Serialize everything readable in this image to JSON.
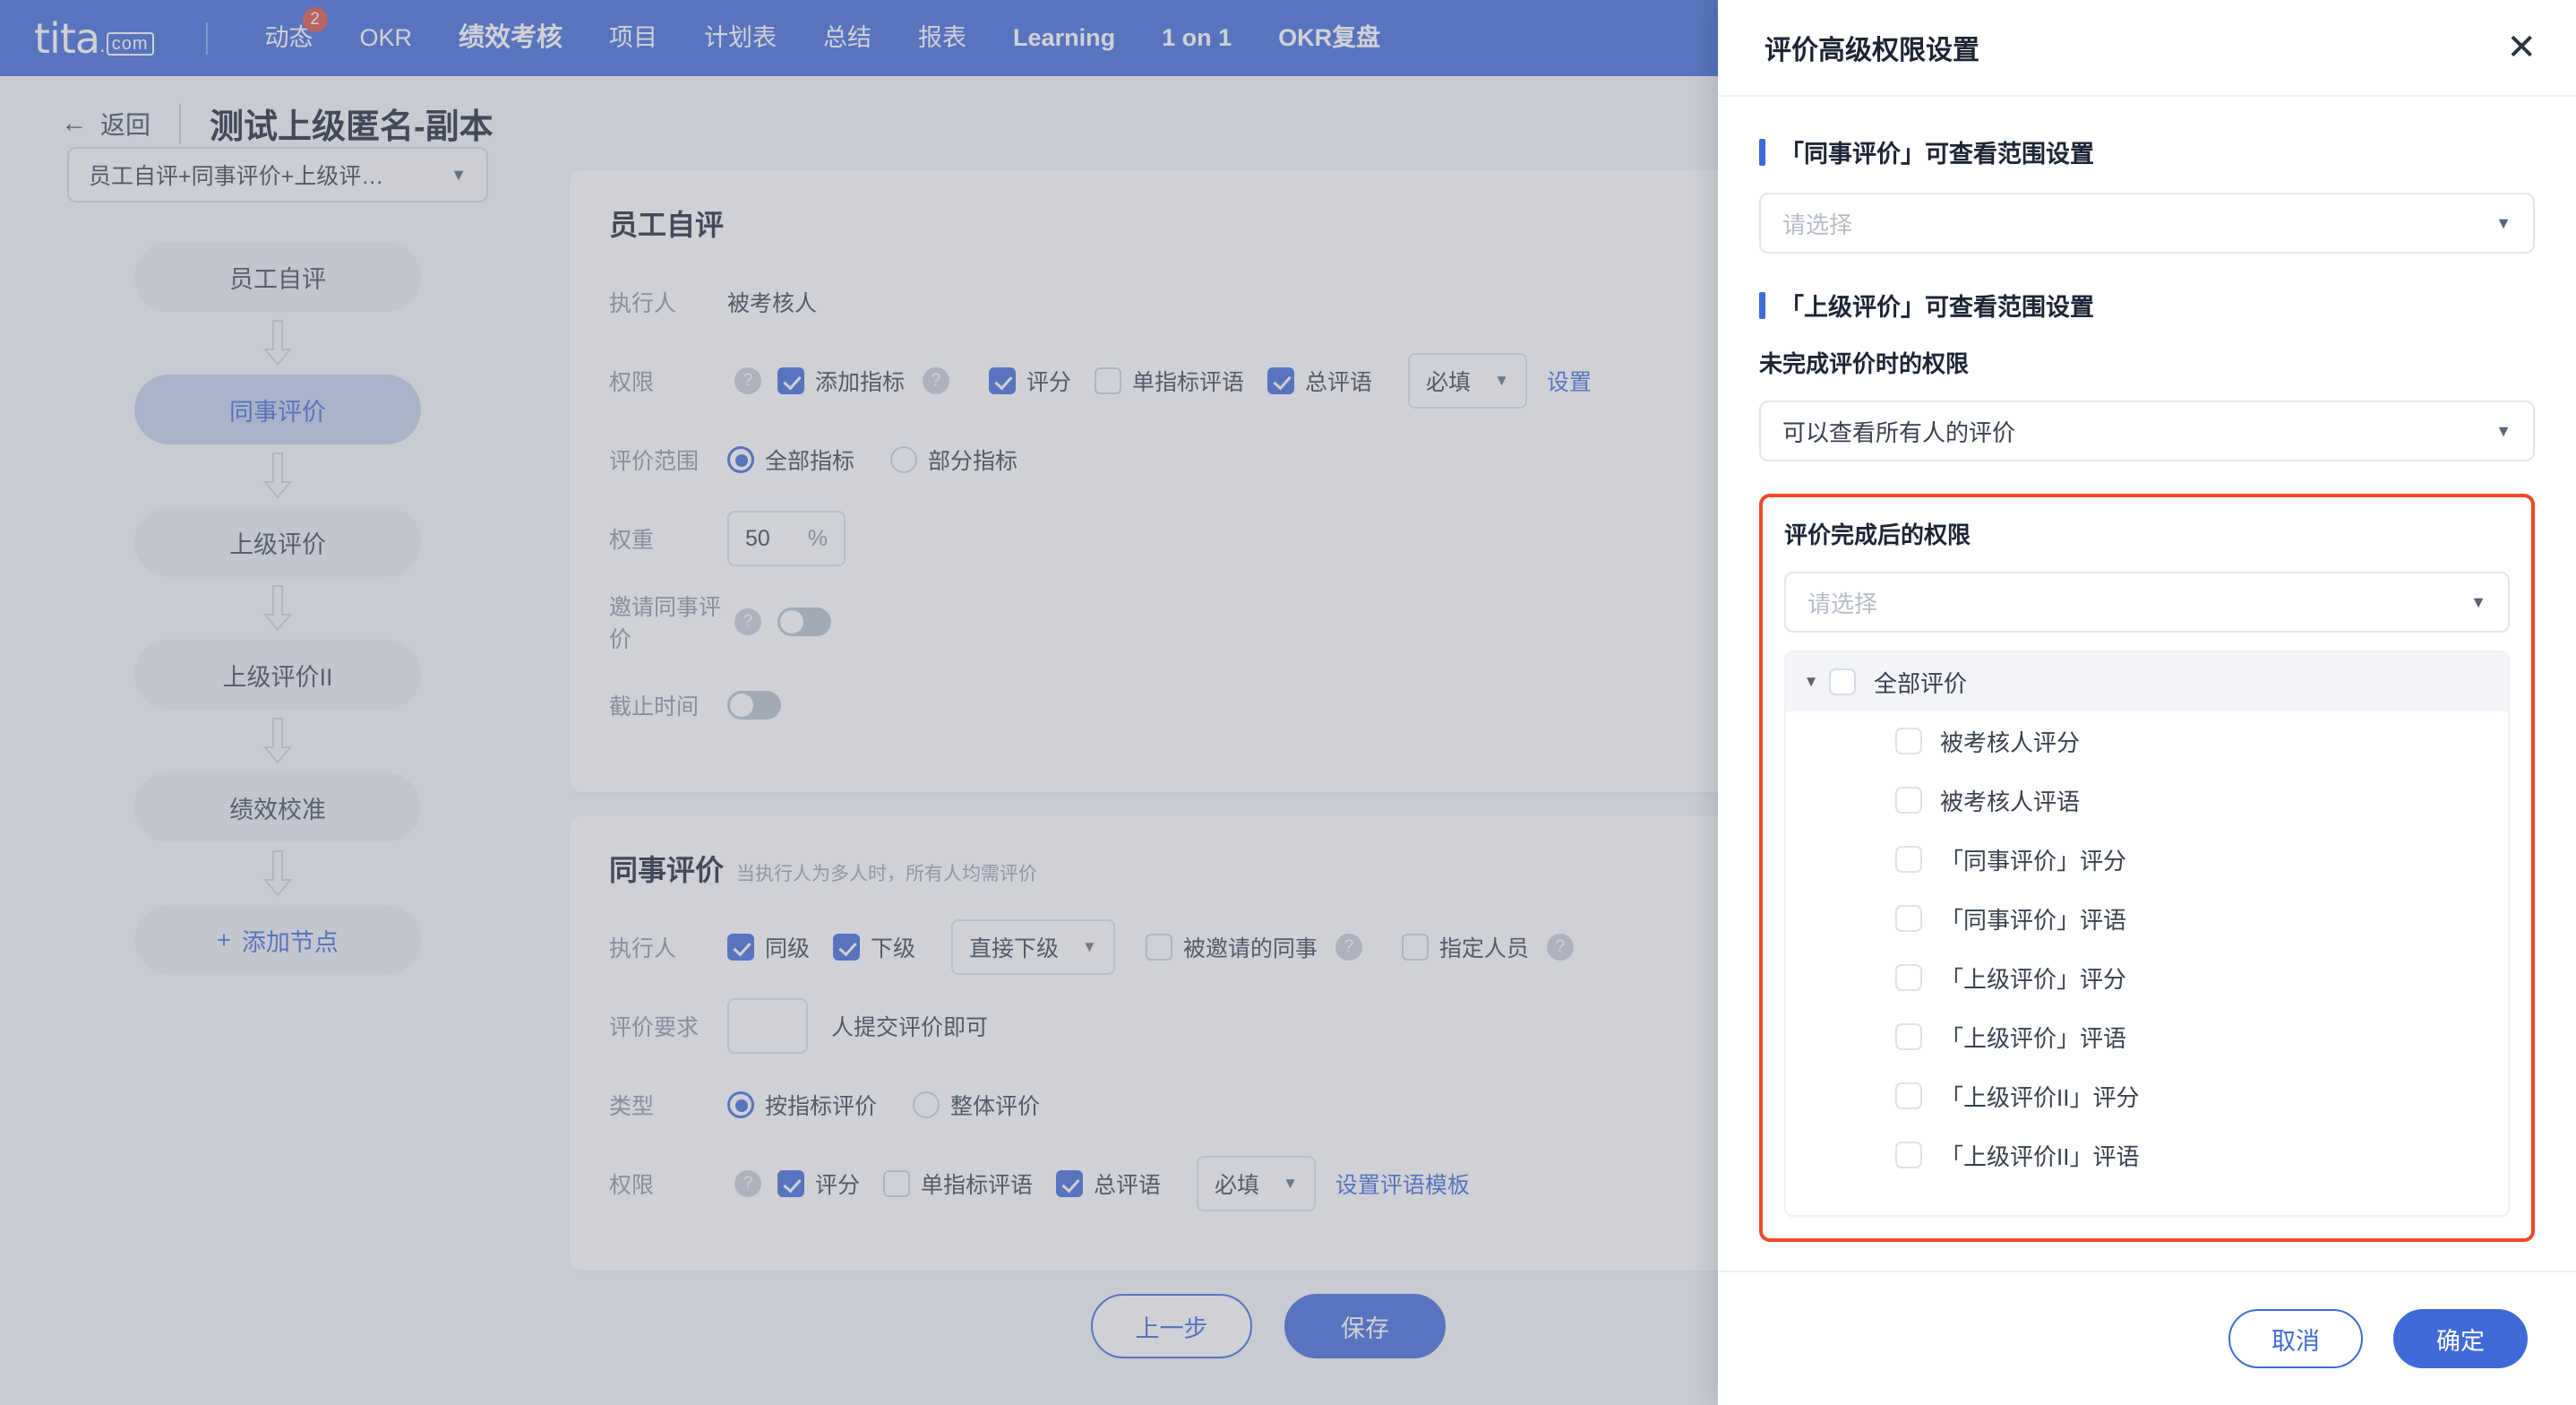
{
  "theme": {
    "brand": "#3f6ad8",
    "badge": "#d94f45",
    "highlight": "#f04a23",
    "panel_bg": "#ffffff",
    "page_bg": "#f5f6f8"
  },
  "topnav": {
    "logo_main": "tita",
    "logo_dot": ".",
    "logo_com": "com",
    "items": [
      {
        "label": "动态",
        "badge": "2",
        "active": false
      },
      {
        "label": "OKR",
        "badge": "",
        "active": false
      },
      {
        "label": "绩效考核",
        "badge": "",
        "active": true
      },
      {
        "label": "项目",
        "badge": "",
        "active": false
      },
      {
        "label": "计划表",
        "badge": "",
        "active": false
      },
      {
        "label": "总结",
        "badge": "",
        "active": false
      },
      {
        "label": "报表",
        "badge": "",
        "active": false
      },
      {
        "label": "Learning",
        "badge": "",
        "active": true
      },
      {
        "label": "1 on 1",
        "badge": "",
        "active": true
      },
      {
        "label": "OKR复盘",
        "badge": "",
        "active": true
      }
    ]
  },
  "page_header": {
    "back_label": "返回",
    "back_icon": "arrow-left-icon",
    "title": "测试上级匿名-副本"
  },
  "rail": {
    "template_select": {
      "value": "员工自评+同事评价+上级评…",
      "caret": "▼"
    },
    "nodes": [
      {
        "label": "员工自评",
        "active": false
      },
      {
        "label": "同事评价",
        "active": true
      },
      {
        "label": "上级评价",
        "active": false
      },
      {
        "label": "上级评价II",
        "active": false
      },
      {
        "label": "绩效校准",
        "active": false
      }
    ],
    "add_node_label": "添加节点",
    "add_node_icon": "plus-icon"
  },
  "cards": [
    {
      "title": "员工自评",
      "subtitle": "",
      "rows": [
        {
          "kind": "text",
          "label": "执行人",
          "value": "被考核人"
        },
        {
          "kind": "perm",
          "label": "权限",
          "help": "?",
          "checks": [
            {
              "label": "添加指标",
              "checked": true,
              "help": "?"
            },
            {
              "label": "评分",
              "checked": true,
              "help": ""
            },
            {
              "label": "单指标评语",
              "checked": false,
              "help": ""
            },
            {
              "label": "总评语",
              "checked": true,
              "help": ""
            }
          ],
          "select_value": "必填",
          "link": "设置"
        },
        {
          "kind": "radio",
          "label": "评价范围",
          "options": [
            {
              "label": "全部指标",
              "selected": true
            },
            {
              "label": "部分指标",
              "selected": false
            }
          ]
        },
        {
          "kind": "weight",
          "label": "权重",
          "value": "50",
          "unit": "%"
        },
        {
          "kind": "toggle",
          "label": "邀请同事评价",
          "help": "?",
          "on": false
        },
        {
          "kind": "toggle",
          "label": "截止时间",
          "help": "",
          "on": false
        }
      ]
    },
    {
      "title": "同事评价",
      "subtitle": "当执行人为多人时，所有人均需评价",
      "rows": [
        {
          "kind": "executor",
          "label": "执行人",
          "checks": [
            {
              "label": "同级",
              "checked": true,
              "help": ""
            },
            {
              "label": "下级",
              "checked": true,
              "help": ""
            }
          ],
          "select_value": "直接下级",
          "tail_checks": [
            {
              "label": "被邀请的同事",
              "checked": false,
              "help": "?"
            },
            {
              "label": "指定人员",
              "checked": false,
              "help": "?"
            }
          ]
        },
        {
          "kind": "requirement",
          "label": "评价要求",
          "value": "",
          "suffix": "人提交评价即可"
        },
        {
          "kind": "radio",
          "label": "类型",
          "options": [
            {
              "label": "按指标评价",
              "selected": true
            },
            {
              "label": "整体评价",
              "selected": false
            }
          ]
        },
        {
          "kind": "perm",
          "label": "权限",
          "help": "?",
          "checks": [
            {
              "label": "评分",
              "checked": true,
              "help": ""
            },
            {
              "label": "单指标评语",
              "checked": false,
              "help": ""
            },
            {
              "label": "总评语",
              "checked": true,
              "help": ""
            }
          ],
          "select_value": "必填",
          "link": "设置评语模板"
        }
      ]
    }
  ],
  "page_actions": {
    "prev_label": "上一步",
    "save_label": "保存"
  },
  "drawer": {
    "title": "评价高级权限设置",
    "close_icon": "close-icon",
    "sections": [
      {
        "title": "「同事评价」可查看范围设置",
        "select_placeholder": "请选择",
        "select_value": ""
      },
      {
        "title": "「上级评价」可查看范围设置",
        "sub_title_1": "未完成评价时的权限",
        "select_value_1": "可以查看所有人的评价",
        "sub_title_2": "评价完成后的权限",
        "select_placeholder_2": "请选择",
        "select_value_2": ""
      }
    ],
    "tree": {
      "root": {
        "label": "全部评价",
        "checked": false,
        "caret": "▼"
      },
      "children": [
        {
          "label": "被考核人评分",
          "checked": false
        },
        {
          "label": "被考核人评语",
          "checked": false
        },
        {
          "label": "「同事评价」评分",
          "checked": false
        },
        {
          "label": "「同事评价」评语",
          "checked": false
        },
        {
          "label": "「上级评价」评分",
          "checked": false
        },
        {
          "label": "「上级评价」评语",
          "checked": false
        },
        {
          "label": "「上级评价II」评分",
          "checked": false
        },
        {
          "label": "「上级评价II」评语",
          "checked": false
        }
      ]
    },
    "footer": {
      "cancel_label": "取消",
      "confirm_label": "确定"
    }
  }
}
